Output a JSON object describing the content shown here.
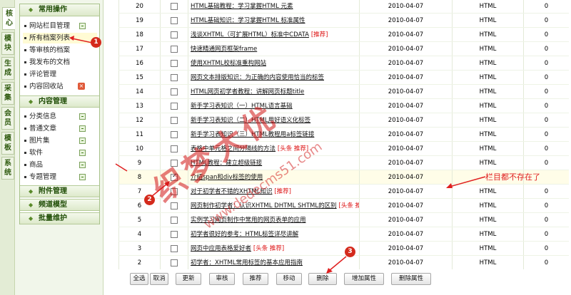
{
  "vertical_tabs": [
    "核心",
    "模块",
    "生成",
    "采集",
    "会员",
    "模板",
    "系统"
  ],
  "sidebar": {
    "sections": [
      {
        "title": "常用操作",
        "items": [
          {
            "label": "网站栏目管理",
            "icon": "plus-icon"
          },
          {
            "label": "所有档案列表",
            "icon": ""
          },
          {
            "label": "等审核的档案",
            "icon": ""
          },
          {
            "label": "我发布的文档",
            "icon": ""
          },
          {
            "label": "评论管理",
            "icon": ""
          },
          {
            "label": "内容回收站",
            "icon": "close-icon"
          }
        ]
      },
      {
        "title": "内容管理",
        "items": [
          {
            "label": "分类信息",
            "icon": "plus-icon"
          },
          {
            "label": "普通文章",
            "icon": "plus-icon"
          },
          {
            "label": "图片集",
            "icon": "plus-icon"
          },
          {
            "label": "软件",
            "icon": "plus-icon"
          },
          {
            "label": "商品",
            "icon": "plus-icon"
          },
          {
            "label": "专题管理",
            "icon": "plus-icon"
          }
        ]
      },
      {
        "title": "附件管理",
        "items": []
      },
      {
        "title": "频道模型",
        "items": []
      },
      {
        "title": "批量维护",
        "items": []
      }
    ]
  },
  "rows": [
    {
      "id": "20",
      "checked": false,
      "title": "HTML基础教程：学习掌握HTML 元素",
      "tag": "",
      "date": "2010-04-07",
      "type": "HTML",
      "count": "0"
    },
    {
      "id": "19",
      "checked": false,
      "title": "HTML基础知识：学习掌握HTML 标准属性",
      "tag": "",
      "date": "2010-04-07",
      "type": "HTML",
      "count": "0"
    },
    {
      "id": "18",
      "checked": false,
      "title": "浅谈XHTML（可扩展HTML）标准中CDATA",
      "tag": "[推荐]",
      "date": "2010-04-07",
      "type": "HTML",
      "count": "0"
    },
    {
      "id": "17",
      "checked": false,
      "title": "快速精通网页框架frame",
      "tag": "",
      "date": "2010-04-07",
      "type": "HTML",
      "count": "0"
    },
    {
      "id": "16",
      "checked": false,
      "title": "使用XHTML校标准重构网站",
      "tag": "",
      "date": "2010-04-07",
      "type": "HTML",
      "count": "0"
    },
    {
      "id": "15",
      "checked": false,
      "title": "网页文本排版知识：为正确的内容使用恰当的标签",
      "tag": "",
      "date": "2010-04-07",
      "type": "HTML",
      "count": "0"
    },
    {
      "id": "14",
      "checked": false,
      "title": "HTML网页初学者教程：讲解网页标题title",
      "tag": "",
      "date": "2010-04-07",
      "type": "HTML",
      "count": "0"
    },
    {
      "id": "13",
      "checked": false,
      "title": "新手学习表知识（一）HTML语言基础",
      "tag": "",
      "date": "2010-04-07",
      "type": "HTML",
      "count": "0"
    },
    {
      "id": "12",
      "checked": false,
      "title": "新手学习表知识（二）HTML用好语义化标签",
      "tag": "",
      "date": "2010-04-07",
      "type": "HTML",
      "count": "0"
    },
    {
      "id": "11",
      "checked": false,
      "title": "新手学习表知识（三）HTML教程用a标签链接",
      "tag": "",
      "date": "2010-04-07",
      "type": "HTML",
      "count": "0"
    },
    {
      "id": "10",
      "checked": false,
      "title": "表格中单元格之间分隔线的方法",
      "tag": "[头条 推荐]",
      "date": "2010-04-07",
      "type": "HTML",
      "count": "0"
    },
    {
      "id": "9",
      "checked": false,
      "title": "HTML教程：建立超级链接",
      "tag": "",
      "date": "2010-04-07",
      "type": "HTML",
      "count": "0"
    },
    {
      "id": "8",
      "checked": true,
      "title": "介绍span和div标签的使用",
      "tag": "",
      "date": "2010-04-07",
      "type": "",
      "count": "",
      "note": "栏目都不存在了"
    },
    {
      "id": "7",
      "checked": false,
      "title": "对于初学者不错的XHTML知识",
      "tag": "[推荐]",
      "date": "2010-04-07",
      "type": "HTML",
      "count": "0"
    },
    {
      "id": "6",
      "checked": false,
      "title": "网页制作初学者：认识XHTML DHTML SHTML的区别",
      "tag": "[头条 推荐]",
      "date": "2010-04-07",
      "type": "HTML",
      "count": "0"
    },
    {
      "id": "5",
      "checked": false,
      "title": "实例学习网页制作中常用的网页表单的应用",
      "tag": "",
      "date": "2010-04-07",
      "type": "HTML",
      "count": "0"
    },
    {
      "id": "4",
      "checked": false,
      "title": "初学者很好的参考：HTML标签详尽讲解",
      "tag": "",
      "date": "2010-04-07",
      "type": "HTML",
      "count": "0"
    },
    {
      "id": "3",
      "checked": false,
      "title": "网页中应用表格爱好者",
      "tag": "[头条 推荐]",
      "date": "2010-04-07",
      "type": "HTML",
      "count": "0"
    },
    {
      "id": "2",
      "checked": false,
      "title": "初学者：XHTML常用标签的基本应用指南",
      "tag": "",
      "date": "2010-04-07",
      "type": "HTML",
      "count": "0"
    }
  ],
  "toolbar": {
    "buttons": [
      "全选",
      "取消",
      "更新",
      "审核",
      "推荐",
      "移动",
      "删除",
      "增加属性",
      "删除属性"
    ]
  },
  "annotations": {
    "badge1": "1",
    "badge2": "2",
    "badge3": "3",
    "note": "栏目都不存在了"
  },
  "watermark": {
    "main": "织梦大优",
    "sub": "www.dedecms51.com"
  }
}
